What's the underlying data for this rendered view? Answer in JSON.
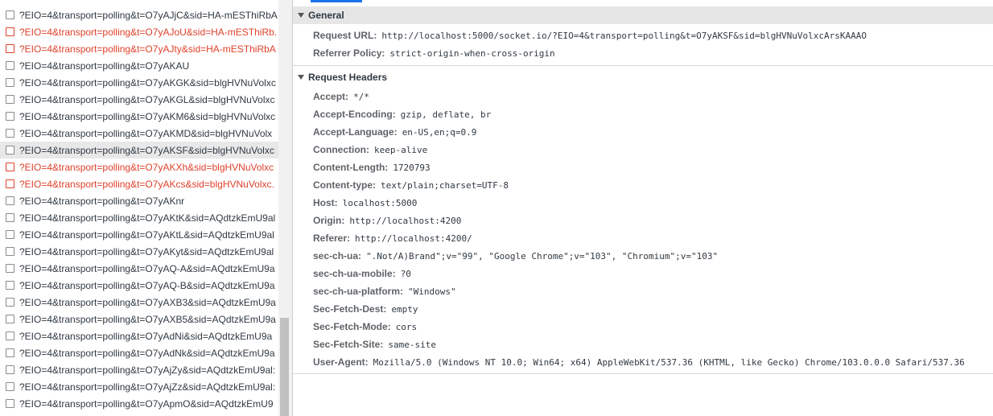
{
  "requests": [
    {
      "name": "?EIO=4&transport=polling&t=O7yAJjC&sid=HA-mESThiRbA",
      "status": "normal"
    },
    {
      "name": "?EIO=4&transport=polling&t=O7yAJoU&sid=HA-mESThiRb.",
      "status": "error"
    },
    {
      "name": "?EIO=4&transport=polling&t=O7yAJty&sid=HA-mESThiRbA",
      "status": "error"
    },
    {
      "name": "?EIO=4&transport=polling&t=O7yAKAU",
      "status": "normal"
    },
    {
      "name": "?EIO=4&transport=polling&t=O7yAKGK&sid=blgHVNuVolxc",
      "status": "normal"
    },
    {
      "name": "?EIO=4&transport=polling&t=O7yAKGL&sid=blgHVNuVolxc",
      "status": "normal"
    },
    {
      "name": "?EIO=4&transport=polling&t=O7yAKM6&sid=blgHVNuVolxc",
      "status": "normal"
    },
    {
      "name": "?EIO=4&transport=polling&t=O7yAKMD&sid=blgHVNuVolx",
      "status": "normal"
    },
    {
      "name": "?EIO=4&transport=polling&t=O7yAKSF&sid=blgHVNuVolxc",
      "status": "selected"
    },
    {
      "name": "?EIO=4&transport=polling&t=O7yAKXh&sid=blgHVNuVolxc",
      "status": "error"
    },
    {
      "name": "?EIO=4&transport=polling&t=O7yAKcs&sid=blgHVNuVolxc.",
      "status": "error"
    },
    {
      "name": "?EIO=4&transport=polling&t=O7yAKnr",
      "status": "normal"
    },
    {
      "name": "?EIO=4&transport=polling&t=O7yAKtK&sid=AQdtzkEmU9al",
      "status": "normal"
    },
    {
      "name": "?EIO=4&transport=polling&t=O7yAKtL&sid=AQdtzkEmU9al",
      "status": "normal"
    },
    {
      "name": "?EIO=4&transport=polling&t=O7yAKyt&sid=AQdtzkEmU9al",
      "status": "normal"
    },
    {
      "name": "?EIO=4&transport=polling&t=O7yAQ-A&sid=AQdtzkEmU9a",
      "status": "normal"
    },
    {
      "name": "?EIO=4&transport=polling&t=O7yAQ-B&sid=AQdtzkEmU9a",
      "status": "normal"
    },
    {
      "name": "?EIO=4&transport=polling&t=O7yAXB3&sid=AQdtzkEmU9a",
      "status": "normal"
    },
    {
      "name": "?EIO=4&transport=polling&t=O7yAXB5&sid=AQdtzkEmU9a",
      "status": "normal"
    },
    {
      "name": "?EIO=4&transport=polling&t=O7yAdNi&sid=AQdtzkEmU9a",
      "status": "normal"
    },
    {
      "name": "?EIO=4&transport=polling&t=O7yAdNk&sid=AQdtzkEmU9a",
      "status": "normal"
    },
    {
      "name": "?EIO=4&transport=polling&t=O7yAjZy&sid=AQdtzkEmU9al:",
      "status": "normal"
    },
    {
      "name": "?EIO=4&transport=polling&t=O7yAjZz&sid=AQdtzkEmU9al:",
      "status": "normal"
    },
    {
      "name": "?EIO=4&transport=polling&t=O7yApmO&sid=AQdtzkEmU9",
      "status": "normal"
    }
  ],
  "general": {
    "title": "General",
    "fields": [
      {
        "key": "Request URL:",
        "value": "http://localhost:5000/socket.io/?EIO=4&transport=polling&t=O7yAKSF&sid=blgHVNuVolxcArsKAAAO"
      },
      {
        "key": "Referrer Policy:",
        "value": "strict-origin-when-cross-origin"
      }
    ]
  },
  "request_headers": {
    "title": "Request Headers",
    "fields": [
      {
        "key": "Accept:",
        "value": "*/*"
      },
      {
        "key": "Accept-Encoding:",
        "value": "gzip, deflate, br"
      },
      {
        "key": "Accept-Language:",
        "value": "en-US,en;q=0.9"
      },
      {
        "key": "Connection:",
        "value": "keep-alive"
      },
      {
        "key": "Content-Length:",
        "value": "1720793"
      },
      {
        "key": "Content-type:",
        "value": "text/plain;charset=UTF-8"
      },
      {
        "key": "Host:",
        "value": "localhost:5000"
      },
      {
        "key": "Origin:",
        "value": "http://localhost:4200"
      },
      {
        "key": "Referer:",
        "value": "http://localhost:4200/"
      },
      {
        "key": "sec-ch-ua:",
        "value": "\".Not/A)Brand\";v=\"99\", \"Google Chrome\";v=\"103\", \"Chromium\";v=\"103\""
      },
      {
        "key": "sec-ch-ua-mobile:",
        "value": "?0"
      },
      {
        "key": "sec-ch-ua-platform:",
        "value": "\"Windows\""
      },
      {
        "key": "Sec-Fetch-Dest:",
        "value": "empty"
      },
      {
        "key": "Sec-Fetch-Mode:",
        "value": "cors"
      },
      {
        "key": "Sec-Fetch-Site:",
        "value": "same-site"
      },
      {
        "key": "User-Agent:",
        "value": "Mozilla/5.0 (Windows NT 10.0; Win64; x64) AppleWebKit/537.36 (KHTML, like Gecko) Chrome/103.0.0.0 Safari/537.36"
      }
    ]
  },
  "colors": {
    "error": "#e0412b",
    "selected_row": "#e8e8e8",
    "tab_accent": "#1a73e8"
  },
  "icons": {
    "section_toggle": "triangle-down-icon",
    "row_checkbox": "checkbox-icon"
  }
}
